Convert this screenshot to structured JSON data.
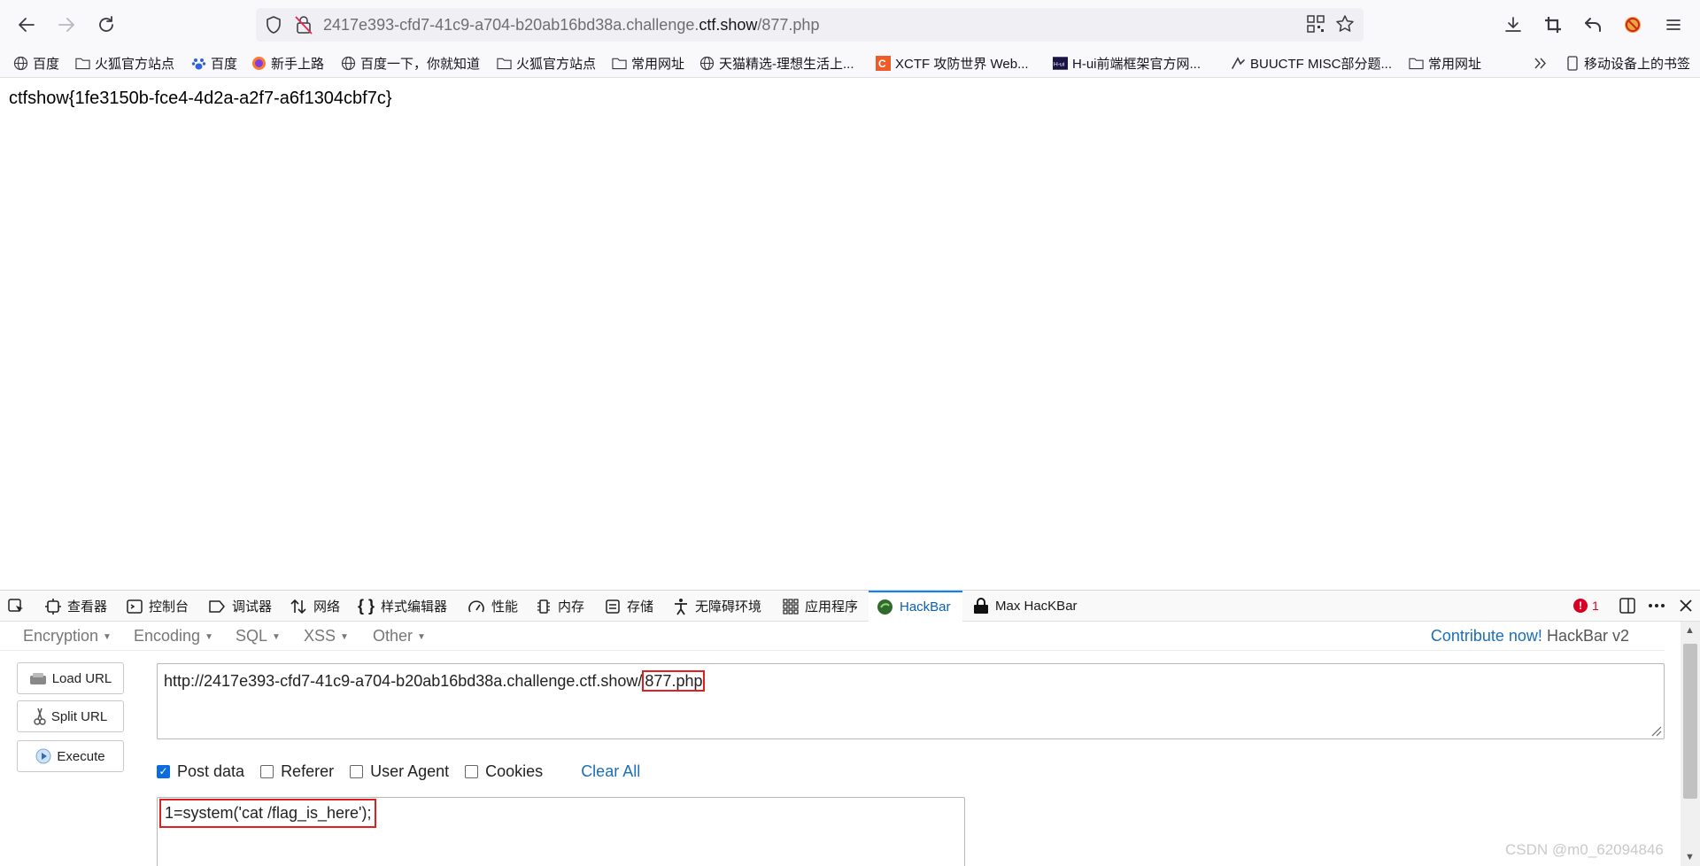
{
  "browser": {
    "url": {
      "prefix": "2417e393-cfd7-41c9-a704-b20ab16bd38a.challenge.",
      "domain": "ctf.show",
      "path": "/877.php"
    }
  },
  "bookmarks": [
    {
      "icon": "globe-icon",
      "label": "百度"
    },
    {
      "icon": "folder-icon",
      "label": "火狐官方站点"
    },
    {
      "icon": "baidu-paw-icon",
      "label": "百度"
    },
    {
      "icon": "firefox-icon",
      "label": "新手上路"
    },
    {
      "icon": "globe-icon",
      "label": "百度一下，你就知道"
    },
    {
      "icon": "folder-icon",
      "label": "火狐官方站点"
    },
    {
      "icon": "folder-icon",
      "label": "常用网址"
    },
    {
      "icon": "globe-icon",
      "label": "天猫精选-理想生活上..."
    },
    {
      "icon": "xctf-logo-icon",
      "label": "XCTF 攻防世界 Web..."
    },
    {
      "icon": "hui-logo-icon",
      "label": "H-ui前端框架官方网..."
    },
    {
      "icon": "buuctf-logo-icon",
      "label": "BUUCTF MISC部分题..."
    },
    {
      "icon": "folder-icon",
      "label": "常用网址"
    }
  ],
  "bookmarks_mobile": "移动设备上的书签",
  "page": {
    "flag": "ctfshow{1fe3150b-fce4-4d2a-a2f7-a6f1304cbf7c}"
  },
  "devtools": {
    "tabs": [
      {
        "icon": "inspector-icon",
        "label": "查看器"
      },
      {
        "icon": "console-icon",
        "label": "控制台"
      },
      {
        "icon": "debugger-icon",
        "label": "调试器"
      },
      {
        "icon": "network-icon",
        "label": "网络"
      },
      {
        "icon": "style-editor-icon",
        "label": "样式编辑器"
      },
      {
        "icon": "performance-icon",
        "label": "性能"
      },
      {
        "icon": "memory-icon",
        "label": "内存"
      },
      {
        "icon": "storage-icon",
        "label": "存储"
      },
      {
        "icon": "accessibility-icon",
        "label": "无障碍环境"
      },
      {
        "icon": "application-icon",
        "label": "应用程序"
      },
      {
        "icon": "hackbar-icon",
        "label": "HackBar"
      },
      {
        "icon": "max-hackbar-icon",
        "label": "Max HacKBar"
      }
    ],
    "error_count": "1"
  },
  "hackbar": {
    "menu": [
      "Encryption",
      "Encoding",
      "SQL",
      "XSS",
      "Other"
    ],
    "contribute_link": "Contribute now!",
    "version": "HackBar v2",
    "buttons": {
      "load": "Load URL",
      "split": "Split URL",
      "execute": "Execute"
    },
    "url_base": "http://2417e393-cfd7-41c9-a704-b20ab16bd38a.challenge.ctf.show/",
    "url_file": "877.php",
    "options": [
      {
        "label": "Post data",
        "checked": true
      },
      {
        "label": "Referer",
        "checked": false
      },
      {
        "label": "User Agent",
        "checked": false
      },
      {
        "label": "Cookies",
        "checked": false
      }
    ],
    "clear_all": "Clear All",
    "post_data": "1=system('cat /flag_is_here');"
  },
  "watermark": "CSDN @m0_62094846"
}
